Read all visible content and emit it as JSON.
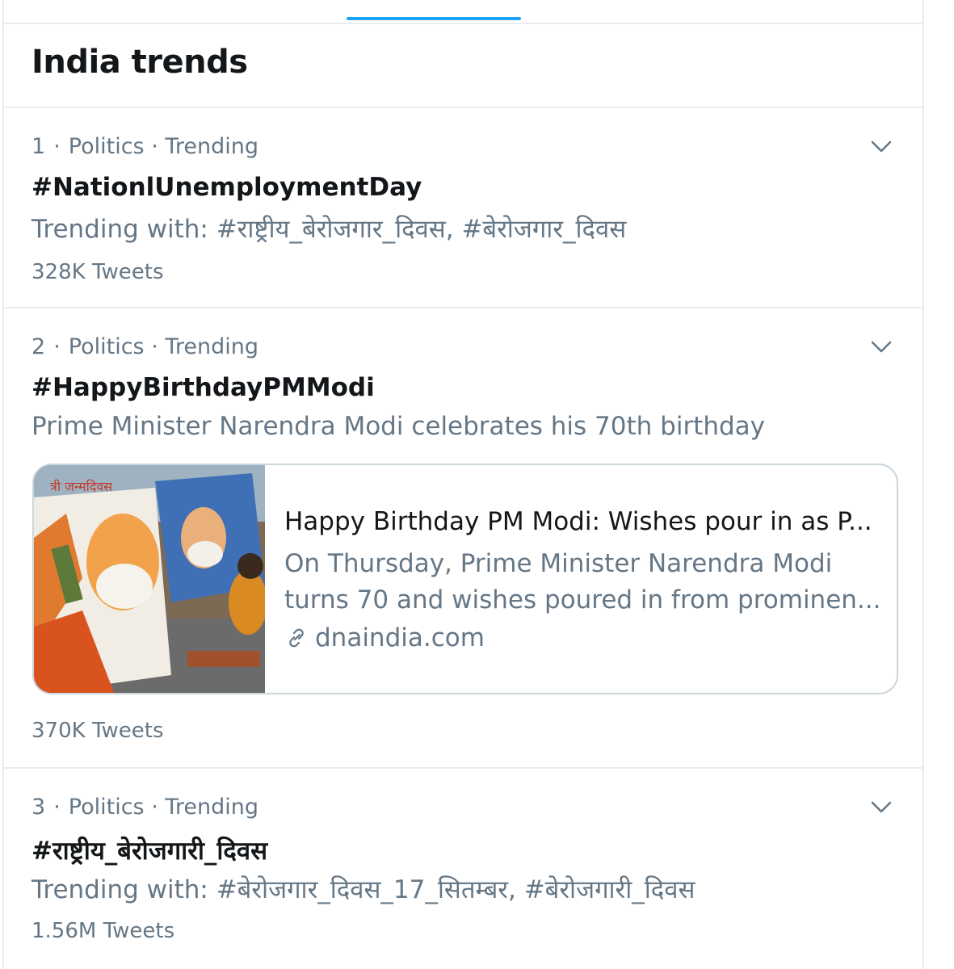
{
  "header": {
    "title": "India trends"
  },
  "trends": [
    {
      "rank": "1",
      "category": "Politics · Trending",
      "name": "#NationlUnemploymentDay",
      "subtitle": "Trending with: #राष्ट्रीय_बेरोजगार_दिवस, #बेरोजगार_दिवस",
      "count": "328K Tweets"
    },
    {
      "rank": "2",
      "category": "Politics · Trending",
      "name": "#HappyBirthdayPMModi",
      "subtitle": "Prime Minister Narendra Modi celebrates his 70th birthday",
      "card": {
        "title": "Happy Birthday PM Modi: Wishes pour in as P...",
        "desc_line1": "On Thursday, Prime Minister Narendra Modi",
        "desc_line2": "turns 70 and wishes poured in from prominen...",
        "domain": "dnaindia.com"
      },
      "count": "370K Tweets"
    },
    {
      "rank": "3",
      "category": "Politics · Trending",
      "name": "#राष्ट्रीय_बेरोजगारी_दिवस",
      "subtitle": "Trending with: #बेरोजगार_दिवस_17_सितम्बर, #बेरोजगारी_दिवस",
      "count": "1.56M Tweets"
    }
  ],
  "colors": {
    "accent": "#1da1f2",
    "secondary_text": "#657786",
    "border": "#e6ecf0"
  },
  "icons": {
    "more": "chevron-down-icon",
    "link": "link-icon"
  }
}
